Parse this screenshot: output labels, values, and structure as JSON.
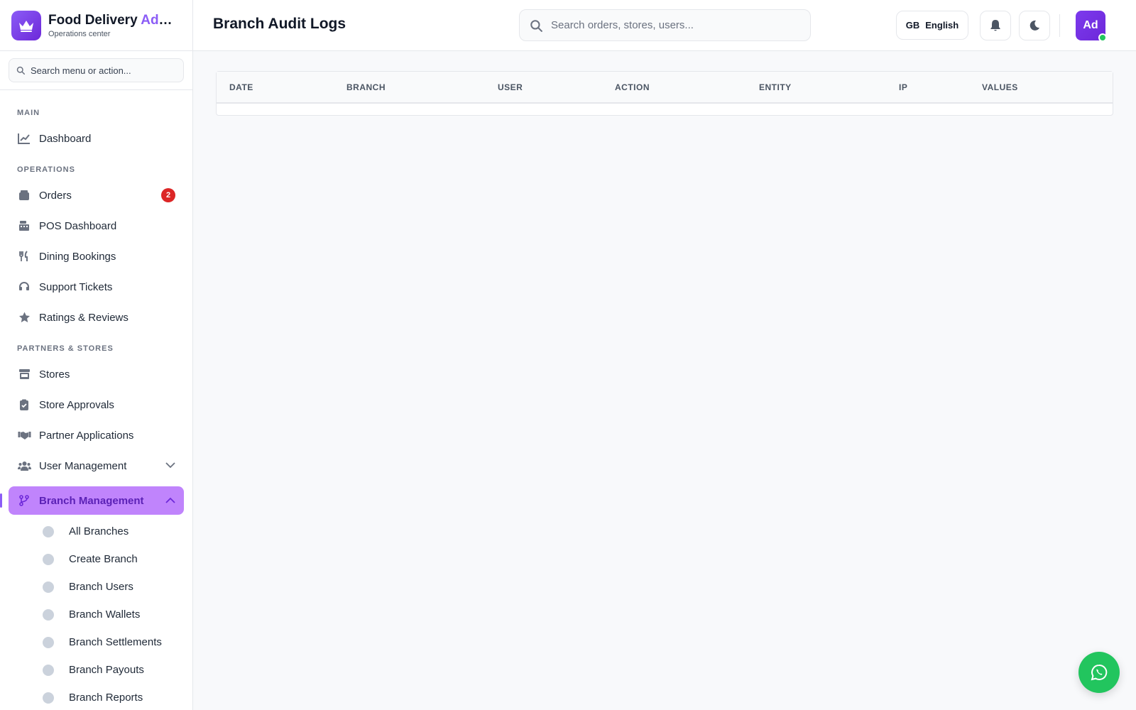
{
  "brand": {
    "title_main": "Food Delivery ",
    "title_accent": "Admin",
    "subtitle": "Operations center",
    "accent_color": "#8b5cf6"
  },
  "sidebar": {
    "search_placeholder": "Search menu or action...",
    "sections": {
      "main": "MAIN",
      "operations": "OPERATIONS",
      "partners": "PARTNERS & STORES"
    },
    "items": {
      "dashboard": "Dashboard",
      "orders": "Orders",
      "orders_badge": "2",
      "pos": "POS Dashboard",
      "dining": "Dining Bookings",
      "support": "Support Tickets",
      "ratings": "Ratings & Reviews",
      "stores": "Stores",
      "store_approvals": "Store Approvals",
      "partner_applications": "Partner Applications",
      "user_management": "User Management",
      "branch_management": "Branch Management"
    },
    "branch_sub": [
      "All Branches",
      "Create Branch",
      "Branch Users",
      "Branch Wallets",
      "Branch Settlements",
      "Branch Payouts",
      "Branch Reports"
    ]
  },
  "header": {
    "page_title": "Branch Audit Logs",
    "search_placeholder": "Search orders, stores, users...",
    "lang_code": "GB",
    "lang_label": "English",
    "avatar_initials": "Ad"
  },
  "table": {
    "columns": [
      "DATE",
      "BRANCH",
      "USER",
      "ACTION",
      "ENTITY",
      "IP",
      "VALUES"
    ],
    "rows": []
  },
  "colors": {
    "active_bg": "#c084fc",
    "active_text": "#5b21b6",
    "badge": "#dc2626",
    "whatsapp": "#22c55e"
  }
}
